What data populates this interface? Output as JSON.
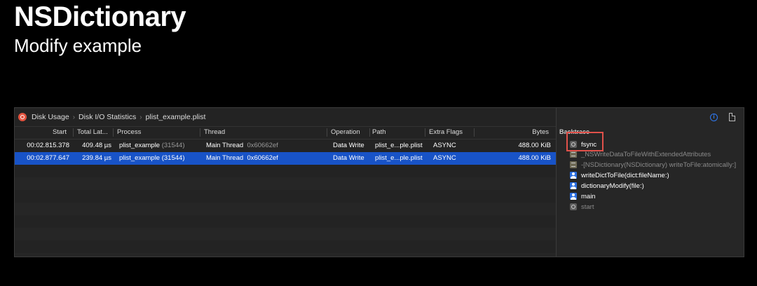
{
  "slide": {
    "title": "NSDictionary",
    "subtitle": "Modify example"
  },
  "breadcrumb": {
    "items": [
      "Disk Usage",
      "Disk I/O Statistics",
      "plist_example.plist"
    ]
  },
  "table": {
    "columns": [
      "Start",
      "Total Lat...",
      "Process",
      "Thread",
      "Operation",
      "Path",
      "Extra Flags",
      "Bytes"
    ],
    "rows": [
      {
        "start": "00:02.815.378",
        "latency": "409.48 µs",
        "process": "plist_example",
        "pid": "(31544)",
        "thread": "Main Thread",
        "thread_id": "0x60662ef",
        "operation": "Data Write",
        "path": "plist_e...ple.plist",
        "flags": "ASYNC",
        "bytes": "488.00 KiB",
        "selected": false
      },
      {
        "start": "00:02.877.647",
        "latency": "239.84 µs",
        "process": "plist_example",
        "pid": "(31544)",
        "thread": "Main Thread",
        "thread_id": "0x60662ef",
        "operation": "Data Write",
        "path": "plist_e...ple.plist",
        "flags": "ASYNC",
        "bytes": "488.00 KiB",
        "selected": true
      }
    ]
  },
  "backtrace": {
    "title": "Backtrace",
    "frames": [
      {
        "label": "fsync",
        "icon": "gear-icon",
        "dim": false
      },
      {
        "label": "_NSWriteDataToFileWithExtendedAttributes",
        "icon": "library-icon",
        "dim": true
      },
      {
        "label": "-[NSDictionary(NSDictionary) writeToFile:atomically:]",
        "icon": "library-icon",
        "dim": true
      },
      {
        "label": "writeDictToFile(dict:fileName:)",
        "icon": "user-code-icon",
        "dim": false
      },
      {
        "label": "dictionaryModify(file:)",
        "icon": "user-code-icon",
        "dim": false
      },
      {
        "label": "main",
        "icon": "user-code-icon",
        "dim": false
      },
      {
        "label": "start",
        "icon": "gear-icon",
        "dim": true
      }
    ]
  },
  "colors": {
    "selection": "#1853c7",
    "highlight": "#e0514a",
    "accent": "#2f7bf5"
  }
}
